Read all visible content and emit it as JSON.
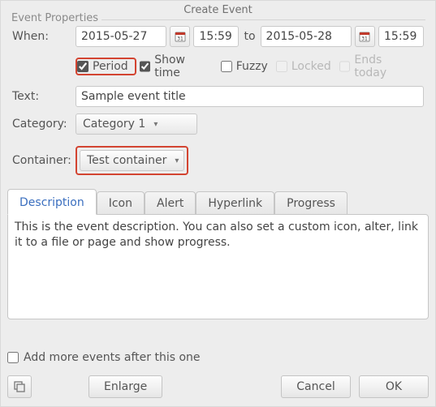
{
  "title": "Create Event",
  "fieldset_label": "Event Properties",
  "labels": {
    "when": "When:",
    "to": "to",
    "text": "Text:",
    "category": "Category:",
    "container": "Container:"
  },
  "when": {
    "start_date": "2015-05-27",
    "start_time": "15:59",
    "end_date": "2015-05-28",
    "end_time": "15:59"
  },
  "options": {
    "period": {
      "label": "Period",
      "checked": true
    },
    "show_time": {
      "label": "Show time",
      "checked": true
    },
    "fuzzy": {
      "label": "Fuzzy",
      "checked": false
    },
    "locked": {
      "label": "Locked",
      "checked": false,
      "disabled": true
    },
    "ends_today": {
      "label": "Ends today",
      "checked": false,
      "disabled": true
    }
  },
  "text_value": "Sample event title",
  "category_value": "Category 1",
  "container_value": "Test container",
  "tabs": {
    "description": "Description",
    "icon": "Icon",
    "alert": "Alert",
    "hyperlink": "Hyperlink",
    "progress": "Progress"
  },
  "description_body": "This is the event description. You can also set a custom icon, alter, link it to a file or page and show progress.",
  "add_more_label": "Add more events after this one",
  "buttons": {
    "enlarge": "Enlarge",
    "cancel": "Cancel",
    "ok": "OK"
  }
}
